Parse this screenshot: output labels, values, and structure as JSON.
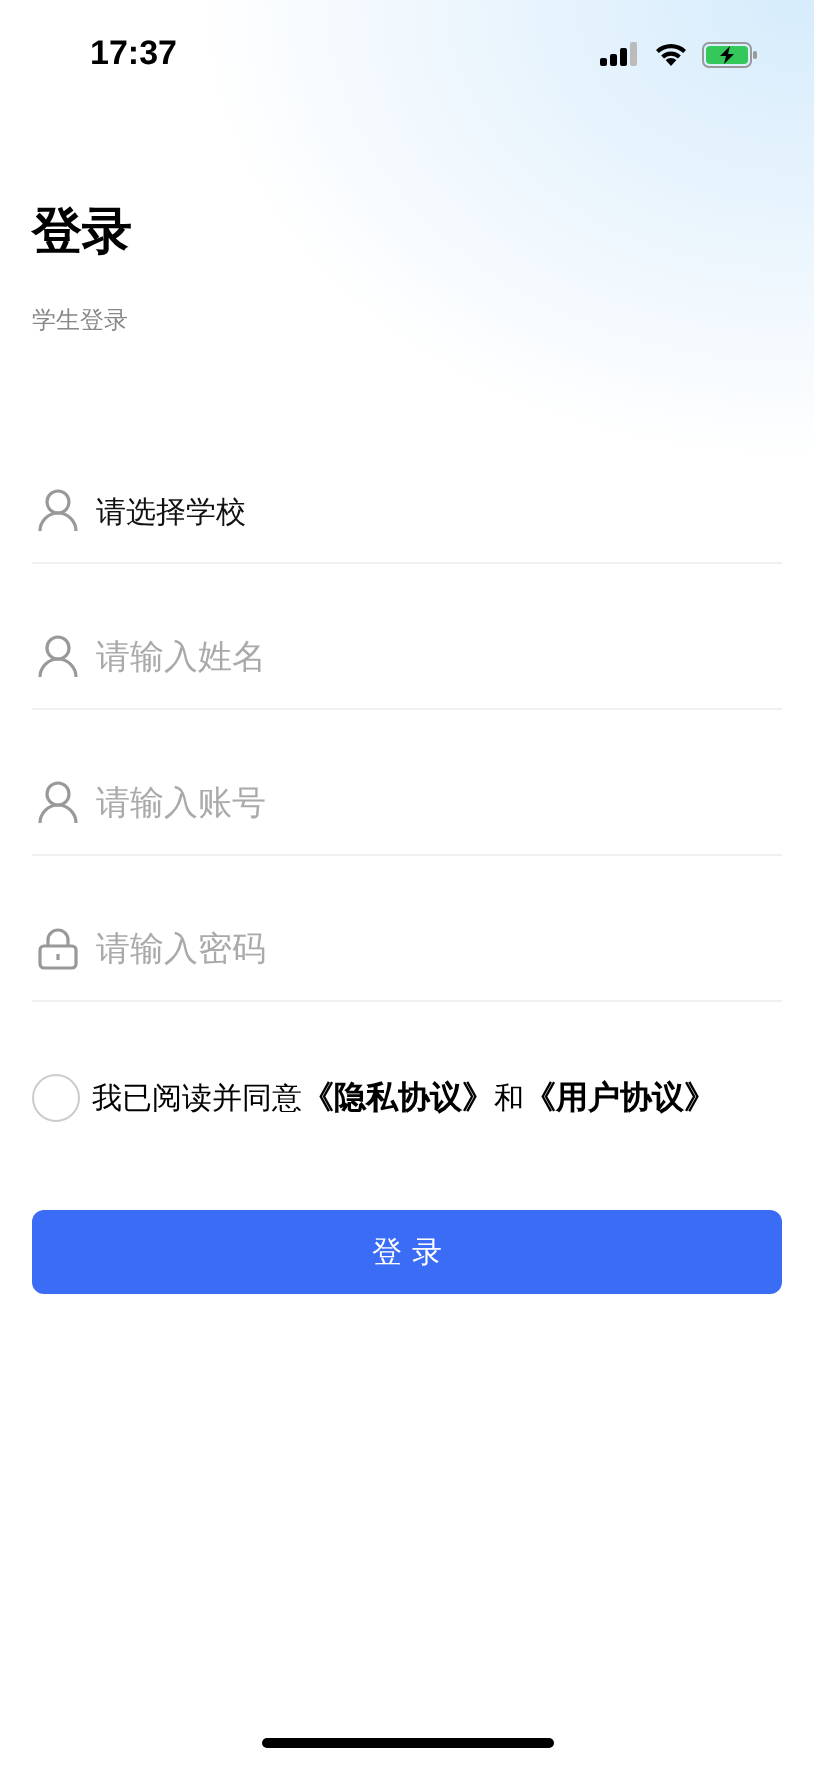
{
  "status_bar": {
    "time": "17:37"
  },
  "title": "登录",
  "subtitle": "学生登录",
  "fields": [
    {
      "kind": "select",
      "value": "请选择学校"
    },
    {
      "kind": "text",
      "placeholder": "请输入姓名"
    },
    {
      "kind": "text",
      "placeholder": "请输入账号"
    },
    {
      "kind": "password",
      "placeholder": "请输入密码"
    }
  ],
  "agreement": {
    "checked": false,
    "text": "我已阅读并同意",
    "link_1": "《隐私协议》",
    "joiner": "和",
    "link_2": "《用户协议》"
  },
  "login_button": "登 录"
}
